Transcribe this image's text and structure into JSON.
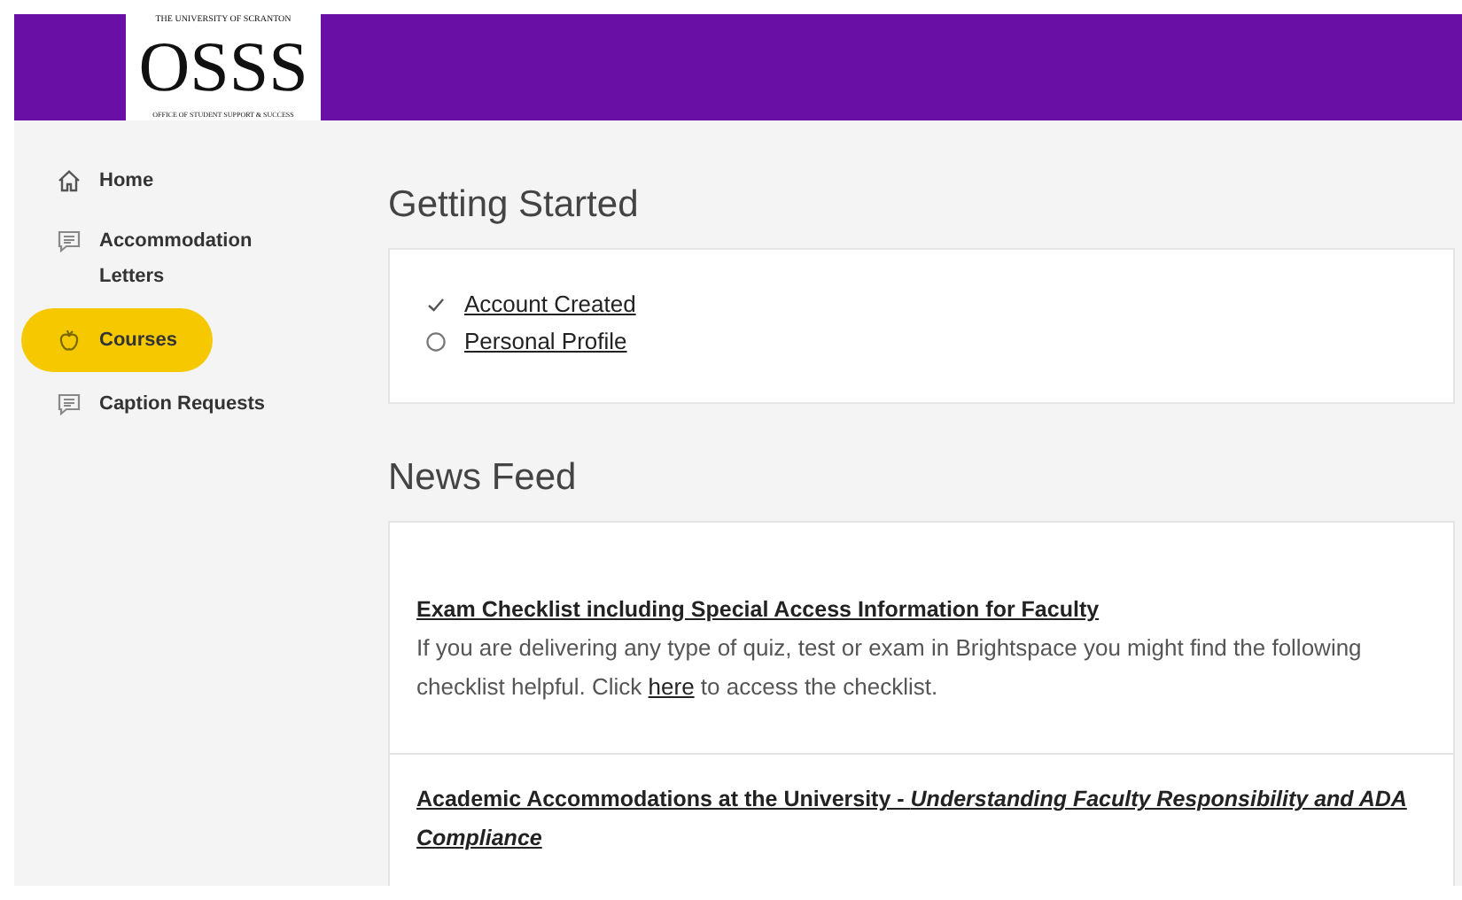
{
  "header": {
    "logo": {
      "top": "THE UNIVERSITY OF SCRANTON",
      "main": "OSSS",
      "bottom": "OFFICE OF STUDENT SUPPORT & SUCCESS"
    }
  },
  "sidebar": {
    "items": [
      {
        "label": "Home",
        "kind": "home",
        "selected": false
      },
      {
        "label": "Accommodation Letters",
        "kind": "message",
        "selected": false
      },
      {
        "label": "Courses",
        "kind": "apple",
        "selected": true
      },
      {
        "label": "Caption Requests",
        "kind": "message",
        "selected": false
      }
    ]
  },
  "getting_started": {
    "title": "Getting Started",
    "steps": [
      {
        "label": "Account Created",
        "checked": true
      },
      {
        "label": "Personal Profile",
        "checked": false
      }
    ]
  },
  "news_feed": {
    "title": "News Feed",
    "items": [
      {
        "title": "Exam Checklist including Special Access Information for Faculty",
        "body_before": "If you are delivering any type of quiz, test or exam in Brightspace you might find the following checklist helpful.  Click",
        "link": "here",
        "body_after": "to access the checklist."
      },
      {
        "title": "Academic Accommodations at the University - *Understanding Faculty Responsibility and ADA Compliance*"
      }
    ]
  }
}
